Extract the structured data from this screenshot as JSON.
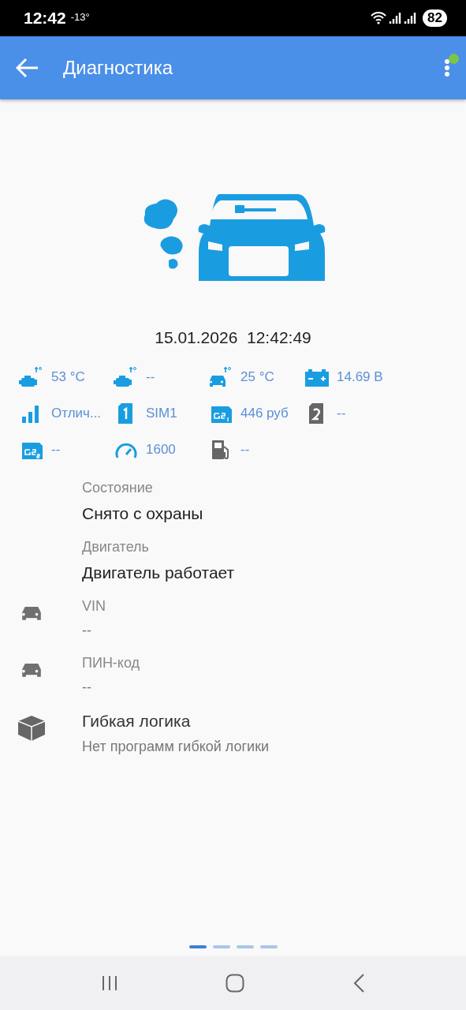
{
  "status_bar": {
    "time": "12:42",
    "temperature": "-13°",
    "battery": "82"
  },
  "app_bar": {
    "title": "Диагностика",
    "online": true
  },
  "timestamp": "15.01.2026  12:42:49",
  "sensors": [
    {
      "kind": "engine-temp",
      "value": "53 °C"
    },
    {
      "kind": "engine-temp",
      "value": "--"
    },
    {
      "kind": "car-temp",
      "value": "25 °C"
    },
    {
      "kind": "battery",
      "value": "14.69 В"
    },
    {
      "kind": "signal",
      "value": "Отлич..."
    },
    {
      "kind": "sim1",
      "value": "SIM1"
    },
    {
      "kind": "gsm1",
      "value": "446 руб"
    },
    {
      "kind": "sim2",
      "value": "--"
    },
    {
      "kind": "gsm2",
      "value": "--"
    },
    {
      "kind": "speed",
      "value": "1600"
    },
    {
      "kind": "fuel",
      "value": "--"
    }
  ],
  "info": [
    {
      "kind": "primary",
      "label": "Состояние",
      "value": "Снято с охраны"
    },
    {
      "kind": "primary",
      "label": "Двигатель",
      "value": "Двигатель работает"
    },
    {
      "kind": "vehicle",
      "label": "VIN",
      "value": "--"
    },
    {
      "kind": "vehicle",
      "label": "ПИН-код",
      "value": "--"
    },
    {
      "kind": "logic",
      "label": "Гибкая логика",
      "value": "Нет программ гибкой логики"
    }
  ],
  "pages": [
    {
      "selected": true
    },
    {
      "selected": false
    },
    {
      "selected": false
    },
    {
      "selected": false
    }
  ]
}
